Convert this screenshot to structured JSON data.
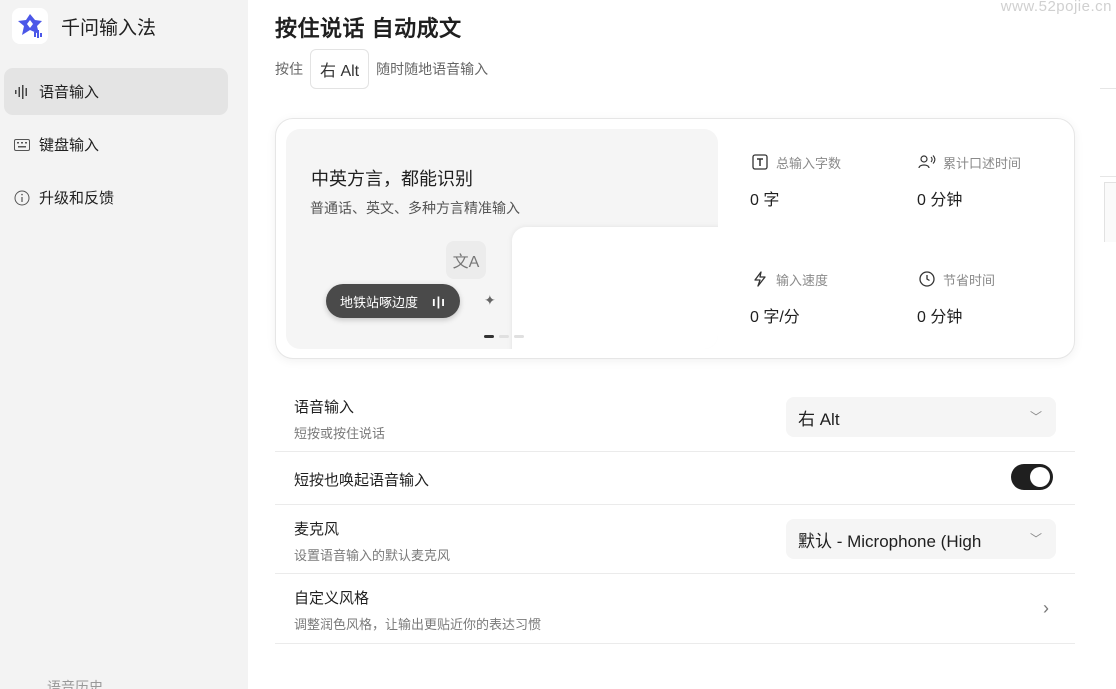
{
  "app": {
    "name": "千问输入法"
  },
  "sidebar": {
    "items": [
      {
        "label": "语音输入",
        "icon": "voice-wave-icon"
      },
      {
        "label": "键盘输入",
        "icon": "keyboard-icon"
      },
      {
        "label": "升级和反馈",
        "icon": "info-icon"
      }
    ]
  },
  "header": {
    "title": "按住说话 自动成文",
    "subtitle_prefix": "按住",
    "hotkey": "右 Alt",
    "subtitle_suffix": "随时随地语音输入"
  },
  "watermark": "www.52pojie.cn",
  "hero": {
    "heading": "中英方言，都能识别",
    "description": "普通话、英文、多种方言精准输入",
    "translate_glyph": "文A",
    "pill_text": "地铁站啄边度",
    "pill_bars": "ı|ı",
    "stats": [
      {
        "label": "总输入字数",
        "value": "0 字",
        "icon": "text-icon"
      },
      {
        "label": "累计口述时间",
        "value": "0 分钟",
        "icon": "speaker-icon"
      },
      {
        "label": "输入速度",
        "value": "0 字/分",
        "icon": "lightning-icon"
      },
      {
        "label": "节省时间",
        "value": "0 分钟",
        "icon": "clock-icon"
      }
    ]
  },
  "settings": {
    "voice_input": {
      "title": "语音输入",
      "desc": "短按或按住说话",
      "value": "右 Alt"
    },
    "short_press": {
      "title": "短按也唤起语音输入",
      "enabled": true
    },
    "microphone": {
      "title": "麦克风",
      "desc": "设置语音输入的默认麦克风",
      "value": "默认 - Microphone (High"
    },
    "custom_style": {
      "title": "自定义风格",
      "desc": "调整润色风格，让输出更贴近你的表达习惯"
    },
    "history_title": "语音历史"
  }
}
